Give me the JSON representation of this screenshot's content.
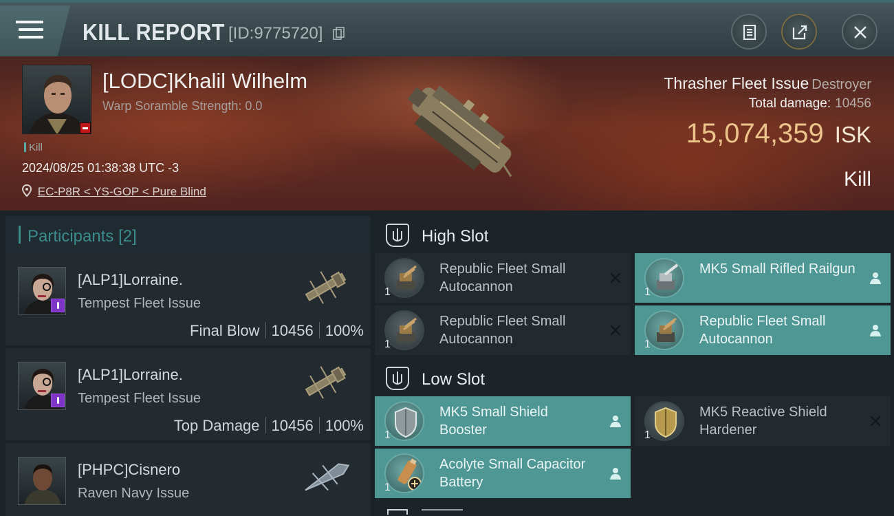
{
  "header": {
    "title": "KILL REPORT",
    "report_id": "[ID:9775720]"
  },
  "victim": {
    "name": "[LODC]Khalil Wilhelm",
    "warp_scramble": "Warp Soramble Strength: 0.0",
    "tag": "Kill",
    "datetime": "2024/08/25 01:38:38 UTC -3",
    "location": "EC-P8R < YS-GOP < Pure Blind",
    "ship_name": "Thrasher Fleet Issue",
    "ship_class": "Destroyer",
    "total_damage_label": "Total damage:",
    "total_damage": "10456",
    "isk_value": "15,074,359",
    "isk_unit": "ISK",
    "result": "Kill"
  },
  "participants": {
    "title": "Participants",
    "count": "[2]",
    "list": [
      {
        "name": "[ALP1]Lorraine.",
        "ship": "Tempest Fleet Issue",
        "role": "Final Blow",
        "damage": "10456",
        "percent": "100%"
      },
      {
        "name": "[ALP1]Lorraine.",
        "ship": "Tempest Fleet Issue",
        "role": "Top Damage",
        "damage": "10456",
        "percent": "100%"
      },
      {
        "name": "[PHPC]Cisnero",
        "ship": "Raven Navy Issue"
      }
    ]
  },
  "fittings": {
    "high_slot": {
      "title": "High Slot",
      "modules": [
        {
          "qty": "1",
          "name": "Republic Fleet Small Autocannon",
          "status": "destroyed"
        },
        {
          "qty": "1",
          "name": "MK5 Small Rifled Railgun",
          "status": "dropped"
        },
        {
          "qty": "1",
          "name": "Republic Fleet Small Autocannon",
          "status": "destroyed"
        },
        {
          "qty": "1",
          "name": "Republic Fleet Small Autocannon",
          "status": "dropped"
        }
      ]
    },
    "low_slot": {
      "title": "Low Slot",
      "modules": [
        {
          "qty": "1",
          "name": "MK5 Small Shield Booster",
          "status": "dropped"
        },
        {
          "qty": "1",
          "name": "MK5 Reactive Shield Hardener",
          "status": "destroyed"
        },
        {
          "qty": "1",
          "name": "Acolyte Small Capacitor Battery",
          "status": "dropped"
        }
      ]
    }
  },
  "colors": {
    "accent_teal": "#4e9794",
    "isk_gold": "#ecc48b",
    "badge_red": "#c0171b",
    "badge_purple": "#7e34c6"
  },
  "icons": [
    "menu-icon",
    "copy-icon",
    "clipboard-icon",
    "share-icon",
    "close-icon",
    "location-pin-icon",
    "slot-icon",
    "destroyed-x-icon",
    "dropped-person-icon"
  ]
}
